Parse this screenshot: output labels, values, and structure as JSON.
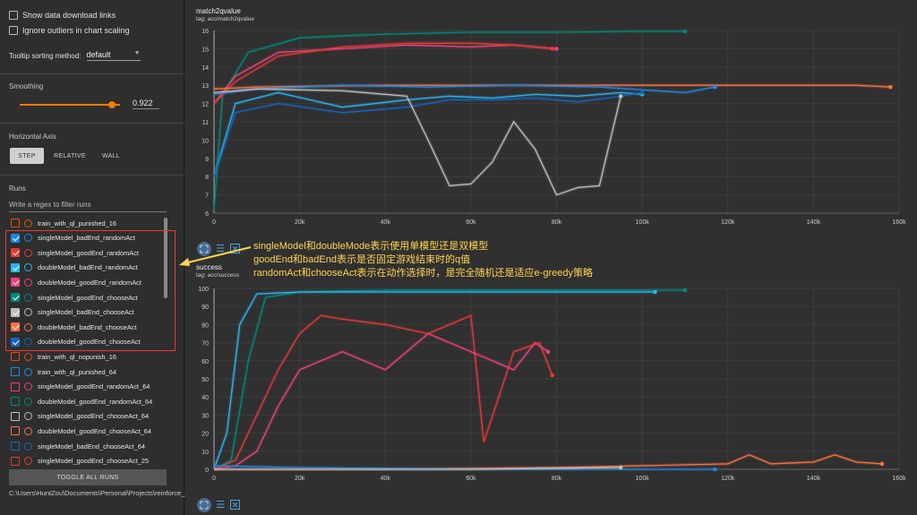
{
  "sidebar": {
    "show_download_label": "Show data download links",
    "ignore_outliers_label": "Ignore outliers in chart scaling",
    "tooltip_sorting_label": "Tooltip sorting method:",
    "tooltip_sorting_value": "default",
    "smoothing_label": "Smoothing",
    "smoothing_value": "0.922",
    "smoothing_fraction": 0.922,
    "horizontal_axis_label": "Horizontal Axis",
    "axis_options": [
      "STEP",
      "RELATIVE",
      "WALL"
    ],
    "axis_selected": "STEP",
    "runs_label": "Runs",
    "runs_filter_placeholder": "Write a regex to filter runs",
    "runs": [
      {
        "name": "train_with_ql_punished_16",
        "color": "#e65100",
        "checked": false
      },
      {
        "name": "singleModel_badEnd_randomAct",
        "color": "#1e88e5",
        "checked": true
      },
      {
        "name": "singleModel_goodEnd_randomAct",
        "color": "#e53935",
        "checked": true
      },
      {
        "name": "doubleModel_badEnd_randomAct",
        "color": "#29b6f6",
        "checked": true
      },
      {
        "name": "doubleModel_goodEnd_randomAct",
        "color": "#ec407a",
        "checked": true
      },
      {
        "name": "singleModel_goodEnd_chooseAct",
        "color": "#00897b",
        "checked": true
      },
      {
        "name": "singleModel_badEnd_chooseAct",
        "color": "#bdbdbd",
        "checked": true
      },
      {
        "name": "doubleModel_badEnd_chooseAct",
        "color": "#ff7043",
        "checked": true
      },
      {
        "name": "doubleModel_goodEnd_chooseAct",
        "color": "#1565c0",
        "checked": true
      },
      {
        "name": "train_with_ql_nopunish_16",
        "color": "#e64a19",
        "checked": false
      },
      {
        "name": "train_with_ql_punished_64",
        "color": "#1e88e5",
        "checked": false
      },
      {
        "name": "singleModel_goodEnd_randomAct_64",
        "color": "#ec407a",
        "checked": false
      },
      {
        "name": "doubleModel_goodEnd_randomAct_64",
        "color": "#00897b",
        "checked": false
      },
      {
        "name": "singleModel_goodEnd_chooseAct_64",
        "color": "#bdbdbd",
        "checked": false
      },
      {
        "name": "doubleModel_goodEnd_chooseAct_64",
        "color": "#ff7043",
        "checked": false
      },
      {
        "name": "singleModel_badEnd_chooseAct_64",
        "color": "#1565c0",
        "checked": false
      },
      {
        "name": "singleModel_goodEnd_chooseAct_25",
        "color": "#e53935",
        "checked": false
      }
    ],
    "toggle_all_label": "TOGGLE ALL RUNS",
    "logdir_path": "C:\\Users\\HuntZou\\Documents\\Personal\\Projects\\reinforce_study\\log"
  },
  "annotation": {
    "line1": "singleModel和doubleMode表示使用单模型还是双模型",
    "line2": "goodEnd和badEnd表示是否固定游戏结束时的q值",
    "line3": "randomAct和chooseAct表示在动作选择时，是完全随机还是适应e-greedy策略"
  },
  "icons": [
    "expand-icon",
    "list-icon",
    "fit-domain-icon"
  ],
  "chart_data": [
    {
      "type": "line",
      "title": "match2qvalue",
      "tag": "tag: acc/match2qvalue",
      "xlim": [
        0,
        160000
      ],
      "ylim": [
        6,
        16
      ],
      "x_ticks": [
        "0",
        "20k",
        "40k",
        "60k",
        "80k",
        "100k",
        "120k",
        "140k",
        "160k"
      ],
      "y_ticks": [
        "6",
        "7",
        "8",
        "9",
        "10",
        "11",
        "12",
        "13",
        "14",
        "15",
        "16"
      ],
      "series": [
        {
          "color": "#00897b",
          "x": [
            0,
            2000,
            8000,
            20000,
            40000,
            60000,
            80000,
            100000,
            110000
          ],
          "y": [
            6.2,
            12.5,
            14.8,
            15.6,
            15.8,
            15.9,
            15.9,
            15.95,
            15.95
          ]
        },
        {
          "color": "#ec407a",
          "x": [
            0,
            5000,
            15000,
            30000,
            45000,
            60000,
            70000,
            80000
          ],
          "y": [
            12,
            13.5,
            14.8,
            15.0,
            15.2,
            15.1,
            15.2,
            15.0
          ]
        },
        {
          "color": "#e53935",
          "x": [
            0,
            5000,
            15000,
            30000,
            45000,
            60000,
            70000,
            79000
          ],
          "y": [
            12,
            13.2,
            14.6,
            15.1,
            15.3,
            15.3,
            15.2,
            15.0
          ]
        },
        {
          "color": "#ff7043",
          "x": [
            0,
            10000,
            40000,
            80000,
            120000,
            140000,
            150000,
            158000
          ],
          "y": [
            12.8,
            12.9,
            13.0,
            13.0,
            13.0,
            13.0,
            13.0,
            12.9
          ]
        },
        {
          "color": "#1e88e5",
          "x": [
            0,
            10000,
            30000,
            50000,
            70000,
            90000,
            110000,
            117000
          ],
          "y": [
            12.5,
            12.8,
            13.0,
            12.9,
            13.0,
            12.9,
            12.6,
            12.9
          ]
        },
        {
          "color": "#29b6f6",
          "x": [
            0,
            5000,
            15000,
            30000,
            45000,
            55000,
            65000,
            75000,
            85000,
            95000,
            100000
          ],
          "y": [
            8,
            12.0,
            12.6,
            11.8,
            12.2,
            12.4,
            12.3,
            12.5,
            12.4,
            12.6,
            12.5
          ]
        },
        {
          "color": "#1565c0",
          "x": [
            0,
            5000,
            15000,
            30000,
            45000,
            55000,
            65000,
            75000,
            85000,
            95000,
            100000
          ],
          "y": [
            8,
            11.5,
            12.0,
            11.5,
            11.8,
            12.2,
            12.2,
            12.3,
            12.1,
            12.4,
            12.6
          ]
        },
        {
          "color": "#bdbdbd",
          "x": [
            0,
            10000,
            30000,
            45000,
            50000,
            55000,
            60000,
            65000,
            70000,
            75000,
            80000,
            85000,
            90000,
            95000
          ],
          "y": [
            12.6,
            12.8,
            12.7,
            12.4,
            10.0,
            7.5,
            7.6,
            8.8,
            11.0,
            9.5,
            7.0,
            7.4,
            7.5,
            12.4
          ]
        }
      ]
    },
    {
      "type": "line",
      "title": "success",
      "tag": "tag: acc/success",
      "xlim": [
        0,
        160000
      ],
      "ylim": [
        0,
        100
      ],
      "x_ticks": [
        "0",
        "20k",
        "40k",
        "60k",
        "80k",
        "100k",
        "120k",
        "140k",
        "160k"
      ],
      "y_ticks": [
        "0",
        "10",
        "20",
        "30",
        "40",
        "50",
        "60",
        "70",
        "80",
        "90",
        "100"
      ],
      "series": [
        {
          "color": "#00897b",
          "x": [
            0,
            4000,
            8000,
            12000,
            20000,
            40000,
            80000,
            110000
          ],
          "y": [
            0,
            5,
            60,
            95,
            98,
            99,
            99,
            99
          ]
        },
        {
          "color": "#29b6f6",
          "x": [
            0,
            3000,
            6000,
            10000,
            20000,
            40000,
            80000,
            103000
          ],
          "y": [
            0,
            20,
            80,
            97,
            98,
            98,
            98,
            98
          ]
        },
        {
          "color": "#e53935",
          "x": [
            0,
            5000,
            10000,
            15000,
            20000,
            25000,
            30000,
            40000,
            50000,
            60000,
            63000,
            70000,
            76000,
            79000
          ],
          "y": [
            0,
            5,
            30,
            55,
            75,
            85,
            83,
            80,
            75,
            85,
            15,
            65,
            70,
            52
          ]
        },
        {
          "color": "#ec407a",
          "x": [
            0,
            5000,
            10000,
            15000,
            20000,
            25000,
            30000,
            40000,
            50000,
            60000,
            70000,
            75000,
            78000
          ],
          "y": [
            0,
            2,
            10,
            35,
            55,
            60,
            65,
            55,
            75,
            65,
            55,
            70,
            65
          ]
        },
        {
          "color": "#ff7043",
          "x": [
            0,
            20000,
            40000,
            80000,
            100000,
            120000,
            125000,
            130000,
            140000,
            145000,
            150000,
            156000
          ],
          "y": [
            0,
            0,
            0,
            1,
            2,
            3,
            8,
            3,
            4,
            8,
            4,
            3
          ]
        },
        {
          "color": "#1e88e5",
          "x": [
            0,
            20000,
            60000,
            100000,
            117000
          ],
          "y": [
            2,
            1,
            0,
            0,
            0
          ]
        },
        {
          "color": "#bdbdbd",
          "x": [
            0,
            30000,
            60000,
            95000
          ],
          "y": [
            0,
            0,
            0,
            1
          ]
        }
      ]
    }
  ]
}
